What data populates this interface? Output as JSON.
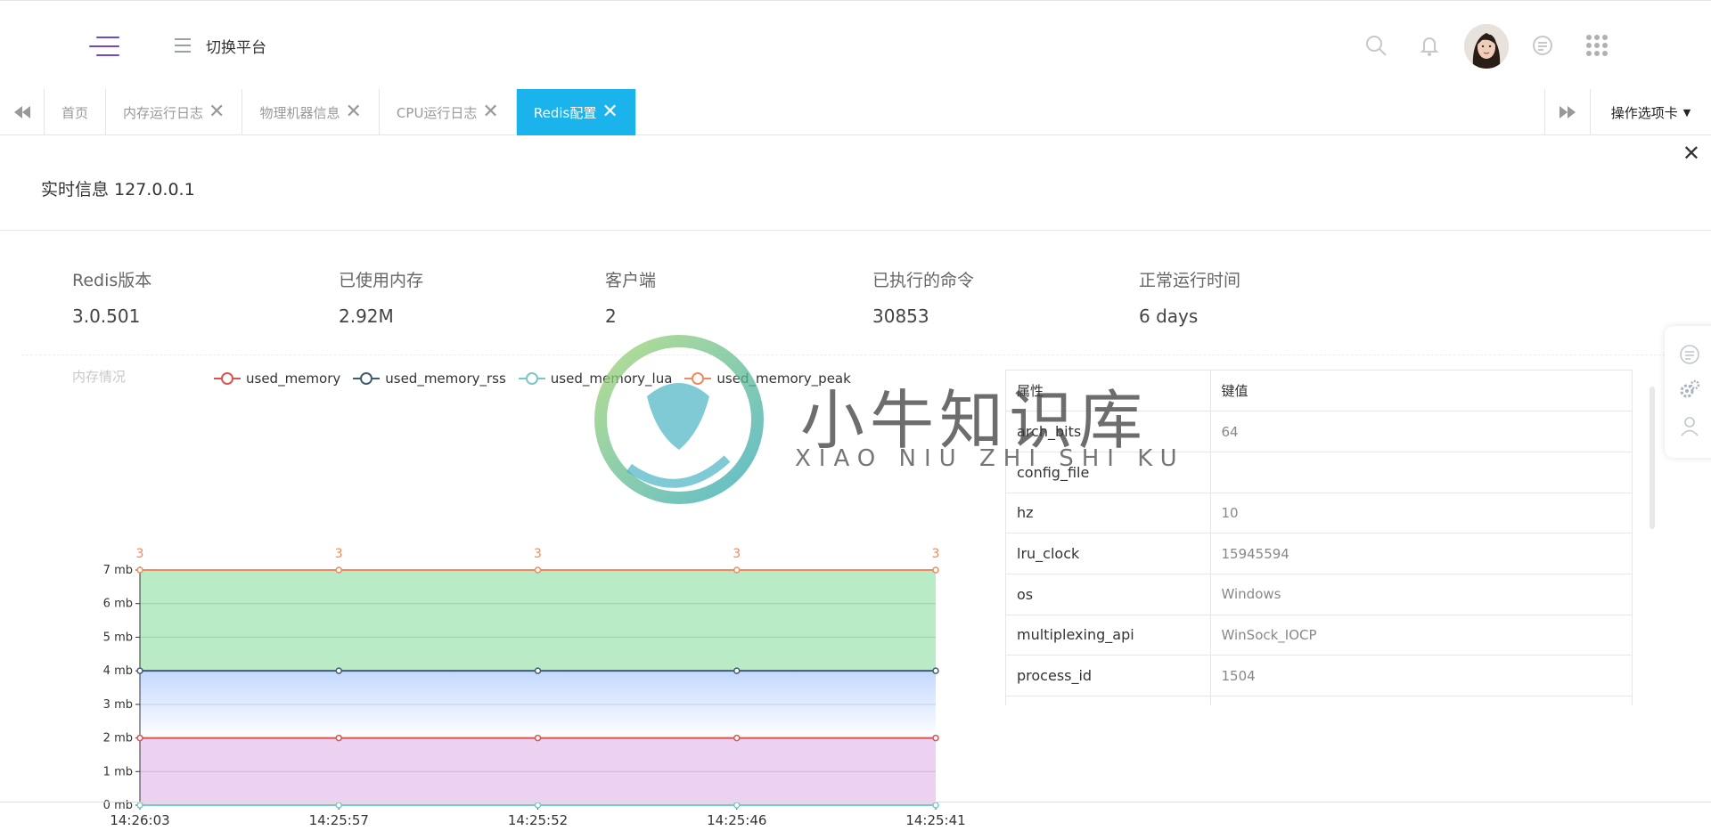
{
  "header": {
    "switch_label": "切换平台"
  },
  "tabs": {
    "items": [
      {
        "label": "首页",
        "closable": false,
        "active": false
      },
      {
        "label": "内存运行日志",
        "closable": true,
        "active": false
      },
      {
        "label": "物理机器信息",
        "closable": true,
        "active": false
      },
      {
        "label": "CPU运行日志",
        "closable": true,
        "active": false
      },
      {
        "label": "Redis配置",
        "closable": true,
        "active": true
      }
    ],
    "ops_label": "操作选项卡"
  },
  "panel": {
    "title": "实时信息 127.0.0.1",
    "stats": [
      {
        "label": "Redis版本",
        "value": "3.0.501"
      },
      {
        "label": "已使用内存",
        "value": "2.92M"
      },
      {
        "label": "客户端",
        "value": "2"
      },
      {
        "label": "已执行的命令",
        "value": "30853"
      },
      {
        "label": "正常运行时间",
        "value": "6 days"
      }
    ],
    "memory_label": "内存情况"
  },
  "chart_data": {
    "type": "area",
    "x": [
      "14:26:03",
      "14:25:57",
      "14:25:52",
      "14:25:46",
      "14:25:41"
    ],
    "ylim": [
      0,
      7
    ],
    "yticks": [
      "0 mb",
      "1 mb",
      "2 mb",
      "3 mb",
      "4 mb",
      "5 mb",
      "6 mb",
      "7 mb"
    ],
    "legend_position": "top",
    "series": [
      {
        "name": "used_memory",
        "values": [
          2,
          2,
          2,
          2,
          2
        ],
        "color": "#d9534f",
        "fill": "#ecd1f3"
      },
      {
        "name": "used_memory_rss",
        "values": [
          4,
          4,
          4,
          4,
          4
        ],
        "color": "#3f5d6e",
        "fill": "#cfe0ff"
      },
      {
        "name": "used_memory_lua",
        "values": [
          0,
          0,
          0,
          0,
          0
        ],
        "color": "#7ac7c7",
        "fill": "none"
      },
      {
        "name": "used_memory_peak",
        "values": [
          7,
          7,
          7,
          7,
          7
        ],
        "color": "#f08a5d",
        "fill": "#b8ebc6"
      }
    ],
    "point_labels": [
      "3",
      "3",
      "3",
      "3",
      "3"
    ]
  },
  "table": {
    "headers": [
      "属性",
      "键值"
    ],
    "rows": [
      [
        "arch_bits",
        "64"
      ],
      [
        "config_file",
        ""
      ],
      [
        "hz",
        "10"
      ],
      [
        "lru_clock",
        "15945594"
      ],
      [
        "os",
        "Windows"
      ],
      [
        "multiplexing_api",
        "WinSock_IOCP"
      ],
      [
        "process_id",
        "1504"
      ],
      [
        "",
        ""
      ]
    ]
  },
  "watermark": {
    "title": "小牛知识库",
    "subtitle": "XIAO NIU ZHI SHI KU"
  },
  "colors": {
    "accent": "#1ab3ec",
    "brand": "#6a4bd6"
  }
}
